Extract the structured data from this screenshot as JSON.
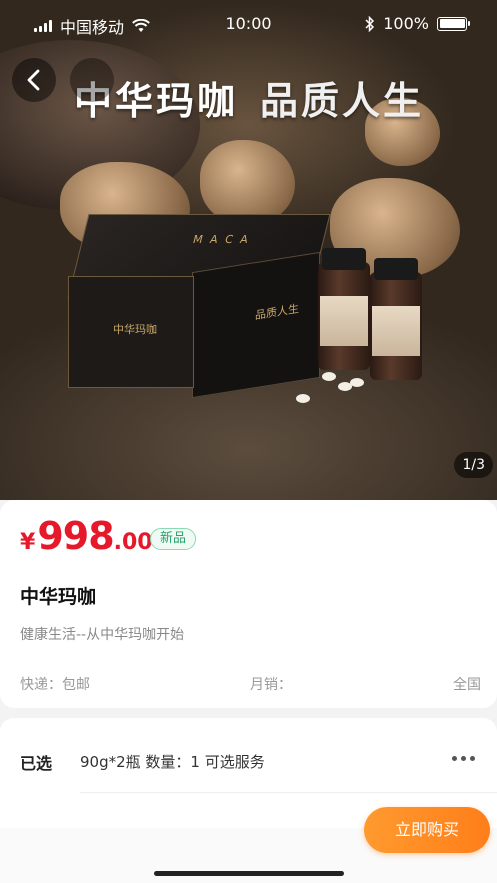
{
  "status_bar": {
    "carrier": "中国移动",
    "time": "10:00",
    "battery": "100%"
  },
  "hero": {
    "banner_left": "中华玛咖",
    "banner_right": "品质人生",
    "box_logo": "中华玛咖",
    "box_side_text": "品质人生",
    "box_top_text": "M A C A",
    "page_indicator": "1/3"
  },
  "product": {
    "price_symbol": "¥",
    "price_integer": "998",
    "price_decimal": ".00",
    "badge": "新品",
    "name": "中华玛咖",
    "subtitle": "健康生活--从中华玛咖开始",
    "shipping": "快递：包邮",
    "monthly_sales": "月销：",
    "region": "全国"
  },
  "selection": {
    "label": "已选",
    "value": "90g*2瓶 数量：1 可选服务"
  },
  "actions": {
    "buy_now": "立即购买"
  },
  "colors": {
    "price": "#e6192b",
    "buy_button": "#ff8c24",
    "badge": "#2aa06a"
  }
}
